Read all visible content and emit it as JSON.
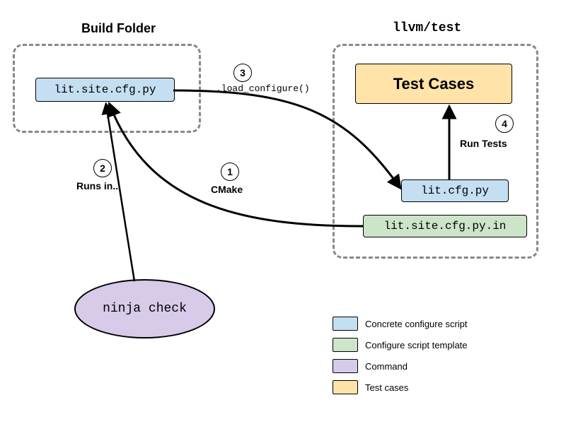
{
  "titles": {
    "build_folder": "Build Folder",
    "llvm_test": "llvm/test"
  },
  "build_folder": {
    "lit_site_cfg": "lit.site.cfg.py"
  },
  "llvm_test": {
    "test_cases": "Test Cases",
    "lit_cfg": "lit.cfg.py",
    "lit_site_cfg_in": "lit.site.cfg.py.in"
  },
  "command": {
    "ninja_check": "ninja check"
  },
  "steps": {
    "1": {
      "num": "1",
      "label": "CMake"
    },
    "2": {
      "num": "2",
      "label": "Runs in..."
    },
    "3": {
      "num": "3",
      "label": ".load_configure()"
    },
    "4": {
      "num": "4",
      "label": "Run Tests"
    }
  },
  "legend": {
    "concrete": "Concrete configure script",
    "template": "Configure script template",
    "command": "Command",
    "tests": "Test cases"
  }
}
